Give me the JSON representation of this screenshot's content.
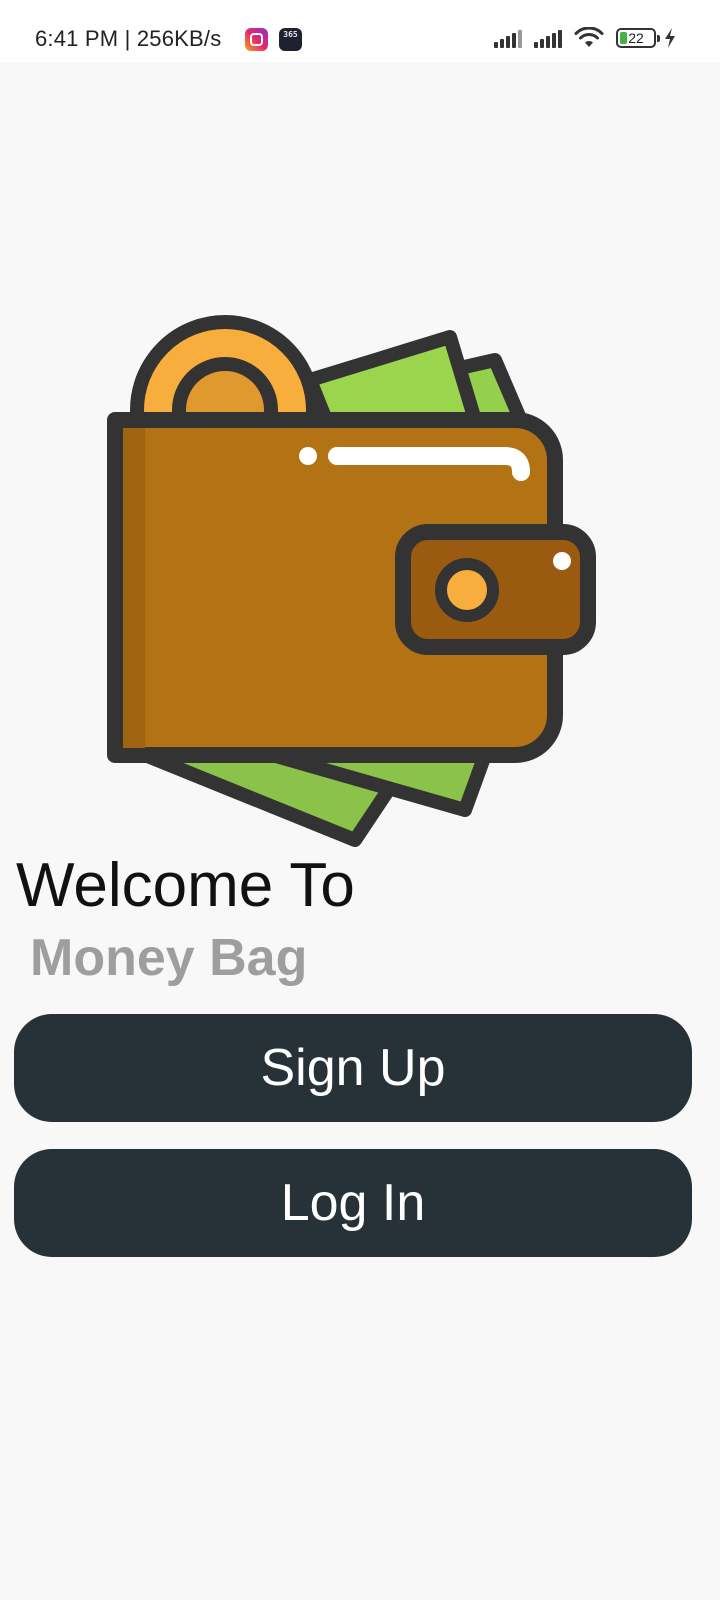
{
  "status_bar": {
    "time_speed": "6:41 PM | 256KB/s",
    "score_app_label": "365",
    "battery_level": "22"
  },
  "icons": {
    "notifications": [
      "instagram-icon",
      "scores-app-icon"
    ],
    "system": [
      "signal-icon",
      "signal-icon-2",
      "wifi-icon",
      "battery-icon",
      "charging-icon"
    ],
    "illustration": "wallet-icon"
  },
  "welcome": {
    "title": "Welcome To",
    "app_name": "Money Bag"
  },
  "buttons": {
    "sign_up": "Sign Up",
    "log_in": "Log In"
  },
  "colors": {
    "button_bg": "#263238",
    "app_name": "#9e9e9e",
    "background": "#f8f8f8"
  }
}
